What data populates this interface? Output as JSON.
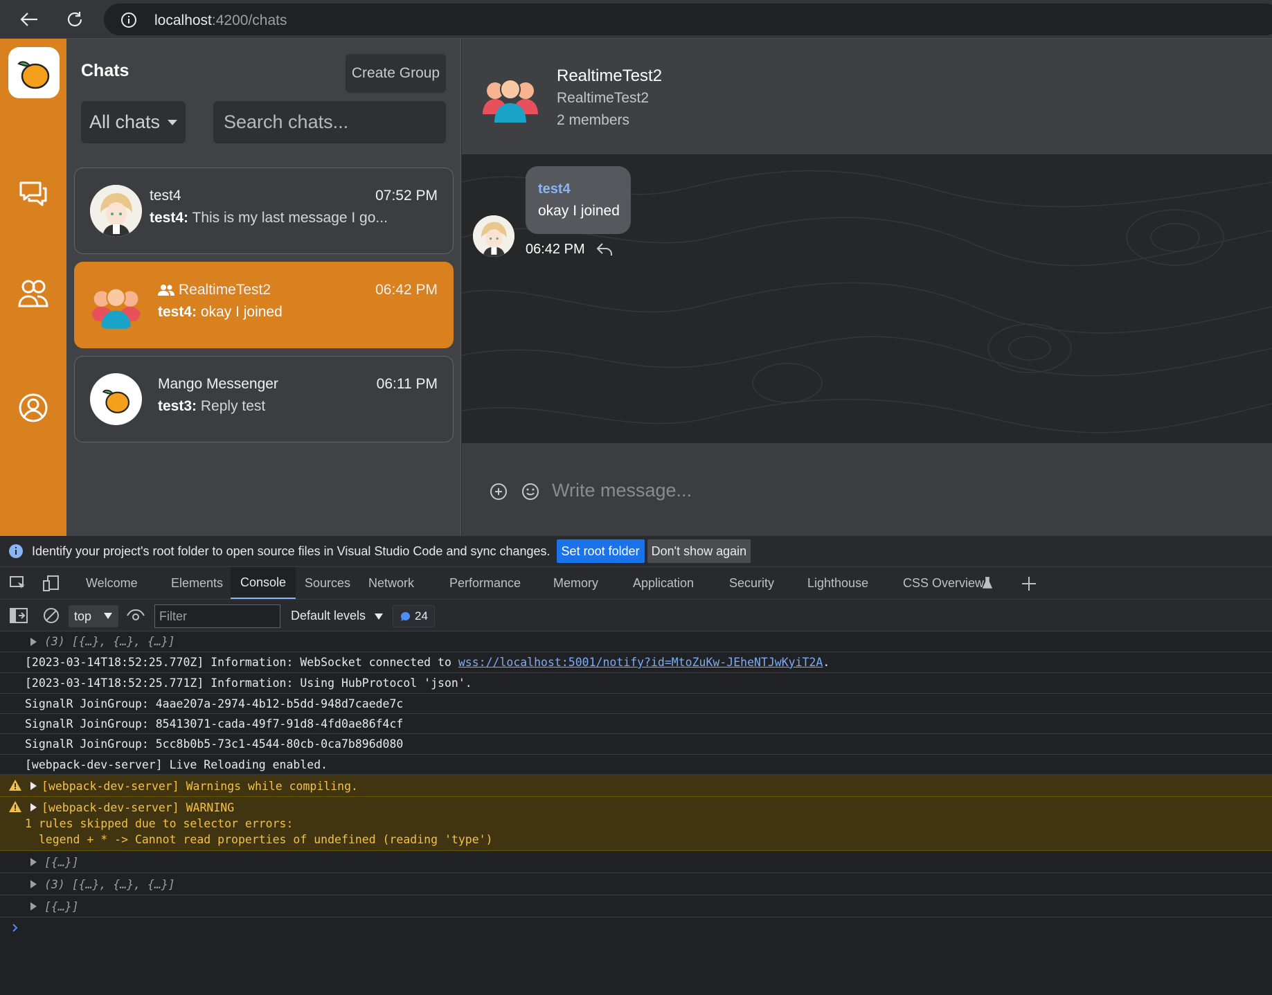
{
  "browser": {
    "url_host": "localhost",
    "url_path": ":4200/chats"
  },
  "app": {
    "sidebar": {
      "title": "Chats",
      "create_group_label": "Create Group",
      "filter_value": "All chats",
      "search_placeholder": "Search chats...",
      "chats": [
        {
          "name": "test4",
          "time": "07:52 PM",
          "sender": "test4:",
          "message": "This is my last message I go..."
        },
        {
          "name": "RealtimeTest2",
          "time": "06:42 PM",
          "sender": "test4:",
          "message": "okay I joined",
          "active": true
        },
        {
          "name": "Mango Messenger",
          "time": "06:11 PM",
          "sender": "test3:",
          "message": "Reply test"
        }
      ]
    },
    "conversation": {
      "title": "RealtimeTest2",
      "subtitle": "RealtimeTest2",
      "members": "2 members",
      "message": {
        "author": "test4",
        "text": "okay I joined",
        "time": "06:42 PM"
      },
      "composer_placeholder": "Write message..."
    },
    "colors": {
      "accent": "#d9801f",
      "link": "#8ab4f8"
    }
  },
  "devtools": {
    "infobar": {
      "text": "Identify your project's root folder to open source files in Visual Studio Code and sync changes.",
      "set_root_label": "Set root folder",
      "dont_show_label": "Don't show again"
    },
    "tabs": [
      "Welcome",
      "Elements",
      "Console",
      "Sources",
      "Network",
      "Performance",
      "Memory",
      "Application",
      "Security",
      "Lighthouse",
      "CSS Overview"
    ],
    "active_tab": "Console",
    "context": "top",
    "filter_placeholder": "Filter",
    "levels": "Default levels",
    "message_count": "24",
    "console_lines": {
      "l0": "(3) [{…}, {…}, {…}]",
      "l1_pre": "[2023-03-14T18:52:25.770Z] Information: WebSocket connected to ",
      "l1_link": "wss://localhost:5001/notify?id=MtoZuKw-JEheNTJwKyiT2A",
      "l1_post": ".",
      "l2": "[2023-03-14T18:52:25.771Z] Information: Using HubProtocol 'json'.",
      "l3": "SignalR JoinGroup: 4aae207a-2974-4b12-b5dd-948d7caede7c",
      "l4": "SignalR JoinGroup: 85413071-cada-49f7-91d8-4fd0ae86f4cf",
      "l5": "SignalR JoinGroup: 5cc8b0b5-73c1-4544-80cb-0ca7b896d080",
      "l6": "[webpack-dev-server] Live Reloading enabled.",
      "w1": "[webpack-dev-server] Warnings while compiling.",
      "w2a": "[webpack-dev-server] WARNING",
      "w2b": "1 rules skipped due to selector errors:",
      "w2c": "  legend + * -> Cannot read properties of undefined (reading 'type')",
      "l7": "[{…}]",
      "l8": "(3) [{…}, {…}, {…}]",
      "l9": "[{…}]"
    }
  }
}
